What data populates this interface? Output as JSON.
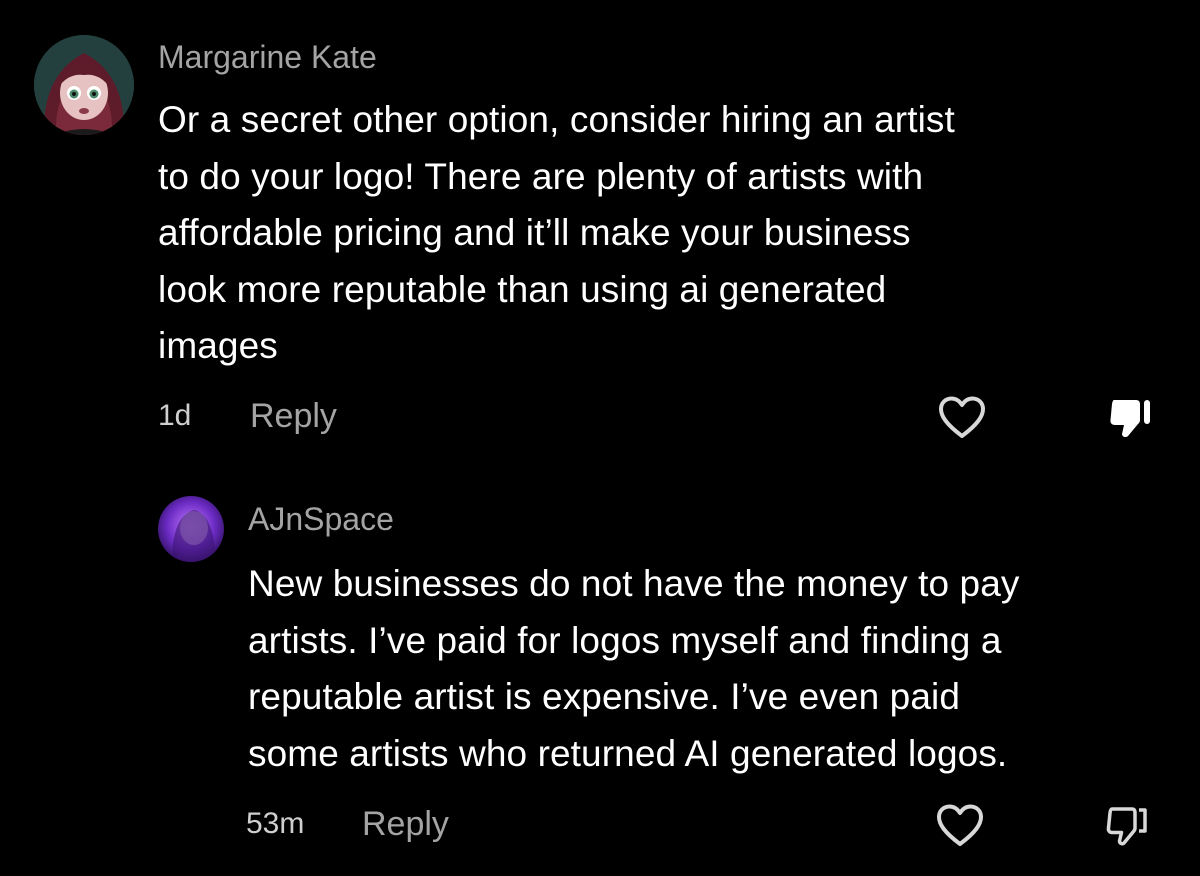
{
  "comments": [
    {
      "username": "Margarine Kate",
      "text": "Or a secret other option, consider hiring an artist\nto do your logo! There are plenty of artists with\naffordable pricing and it’ll make your business\nlook more reputable than using ai generated\nimages",
      "time": "1d",
      "reply_label": "Reply",
      "like_icon": "heart-outline-icon",
      "dislike_icon": "thumbs-down-filled-icon"
    },
    {
      "username": "AJnSpace",
      "text": "New businesses do not have the money to pay\nartists. I’ve paid for logos myself and finding a\nreputable artist is expensive. I’ve even paid\nsome artists who returned AI generated logos.",
      "time": "53m",
      "reply_label": "Reply",
      "like_icon": "heart-outline-icon",
      "dislike_icon": "thumbs-down-outline-icon"
    }
  ],
  "colors": {
    "background": "#000000",
    "username": "#a4a4a4",
    "text": "#ffffff",
    "meta": "#cfcfcf"
  }
}
